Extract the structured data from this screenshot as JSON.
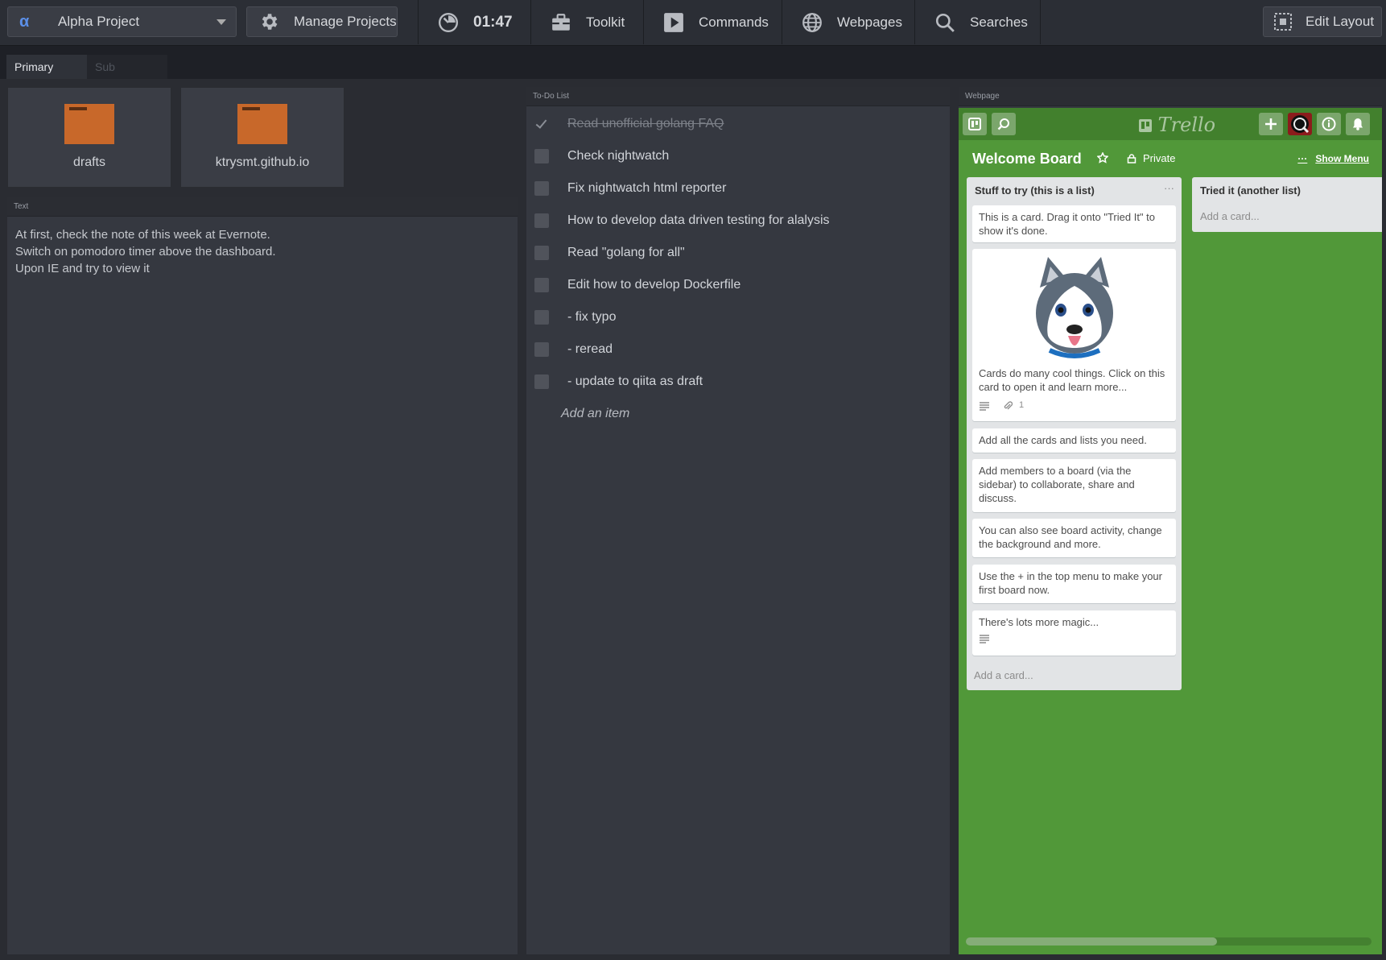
{
  "topbar": {
    "project_name": "Alpha Project",
    "manage_label": "Manage Projects",
    "timer": "01:47",
    "toolkit": "Toolkit",
    "commands": "Commands",
    "webpages": "Webpages",
    "searches": "Searches",
    "edit_layout": "Edit Layout"
  },
  "tabs": {
    "primary": "Primary",
    "sub": "Sub"
  },
  "folders": [
    {
      "name": "drafts"
    },
    {
      "name": "ktrysmt.github.io"
    }
  ],
  "text_panel": {
    "title": "Text",
    "lines": [
      "At first, check the note of this week at Evernote.",
      "Switch on pomodoro timer above the dashboard.",
      "Upon IE and try to view it"
    ]
  },
  "todo_panel": {
    "title": "To-Do List",
    "items": [
      {
        "text": "Read unofficial golang FAQ",
        "done": true
      },
      {
        "text": "Check nightwatch",
        "done": false
      },
      {
        "text": "Fix nightwatch html reporter",
        "done": false
      },
      {
        "text": "How to develop data driven testing for alalysis",
        "done": false
      },
      {
        "text": "Read \"golang for all\"",
        "done": false
      },
      {
        "text": "Edit how to develop Dockerfile",
        "done": false
      },
      {
        "text": "- fix typo",
        "done": false
      },
      {
        "text": "- reread",
        "done": false
      },
      {
        "text": "- update to qiita as draft",
        "done": false
      }
    ],
    "add_label": "Add an item"
  },
  "web_panel": {
    "title": "Webpage",
    "trello": {
      "logo": "Trello",
      "board_title": "Welcome Board",
      "visibility": "Private",
      "show_menu": "Show Menu",
      "list1": {
        "title": "Stuff to try (this is a list)",
        "cards": [
          "This is a card. Drag it onto \"Tried It\" to show it's done.",
          "Cards do many cool things. Click on this card to open it and learn more...",
          "Add all the cards and lists you need.",
          "Add members to a board (via the sidebar) to collaborate, share and discuss.",
          "You can also see board activity, change the background and more.",
          "Use the + in the top menu to make your first board now.",
          "There's lots more magic..."
        ],
        "attachment_count": "1",
        "add_card": "Add a card..."
      },
      "list2": {
        "title": "Tried it (another list)",
        "add_card": "Add a card..."
      },
      "accent": "#519839"
    }
  }
}
